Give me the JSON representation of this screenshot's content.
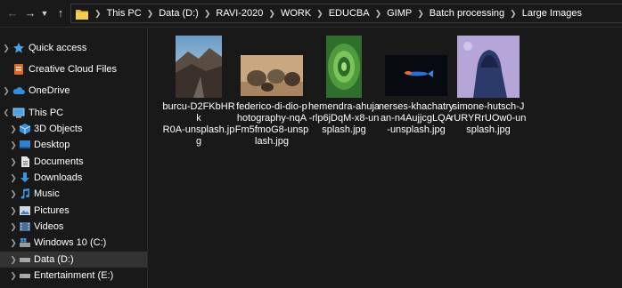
{
  "nav": {
    "back_icon": "arrow-left-icon",
    "forward_icon": "arrow-right-icon",
    "recent_icon": "chevron-down-icon",
    "up_icon": "arrow-up-icon"
  },
  "address_bar": {
    "crumbs": [
      "This PC",
      "Data (D:)",
      "RAVI-2020",
      "WORK",
      "EDUCBA",
      "GIMP",
      "Batch processing",
      "Large Images"
    ]
  },
  "sidebar": {
    "items": [
      {
        "label": "Quick access",
        "icon": "star-icon"
      },
      {
        "label": "Creative Cloud Files",
        "icon": "creative-cloud-icon"
      },
      {
        "label": "OneDrive",
        "icon": "cloud-icon"
      },
      {
        "label": "This PC",
        "icon": "computer-icon"
      },
      {
        "label": "3D Objects",
        "icon": "cube-icon"
      },
      {
        "label": "Desktop",
        "icon": "desktop-icon"
      },
      {
        "label": "Documents",
        "icon": "document-icon"
      },
      {
        "label": "Downloads",
        "icon": "download-icon"
      },
      {
        "label": "Music",
        "icon": "music-icon"
      },
      {
        "label": "Pictures",
        "icon": "pictures-icon"
      },
      {
        "label": "Videos",
        "icon": "video-icon"
      },
      {
        "label": "Windows 10 (C:)",
        "icon": "windows-drive-icon"
      },
      {
        "label": "Data (D:)",
        "icon": "drive-icon"
      },
      {
        "label": "Entertainment (E:)",
        "icon": "drive-icon"
      }
    ],
    "selected": "Data (D:)"
  },
  "files": [
    {
      "name": "burcu-D2FKbHRkR0A-unsplash.jpg",
      "lines": [
        "burcu-D2FKbHRk",
        "R0A-unsplash.jp",
        "g"
      ]
    },
    {
      "name": "federico-di-dio-photography-nqAFm5fmoG8-unsplash.jpg",
      "lines": [
        "federico-di-dio-p",
        "hotography-nqA",
        "Fm5fmoG8-unsp",
        "lash.jpg"
      ]
    },
    {
      "name": "hemendra-ahuja-rlp6jDqM-x8-unsplash.jpg",
      "lines": [
        "hemendra-ahuja",
        "-rlp6jDqM-x8-un",
        "splash.jpg"
      ]
    },
    {
      "name": "nerses-khachatryan-n4AujjcgLQA-unsplash.jpg",
      "lines": [
        "nerses-khachatry",
        "an-n4AujjcgLQA",
        "-unsplash.jpg"
      ]
    },
    {
      "name": "simone-hutsch-JrURYRrUOw0-unsplash.jpg",
      "lines": [
        "simone-hutsch-J",
        "rURYRrUOw0-un",
        "splash.jpg"
      ]
    }
  ],
  "colors": {
    "background": "#191919",
    "selection": "#333333",
    "folder_yellow": "#e8b933",
    "accent_blue": "#3a96dd"
  }
}
